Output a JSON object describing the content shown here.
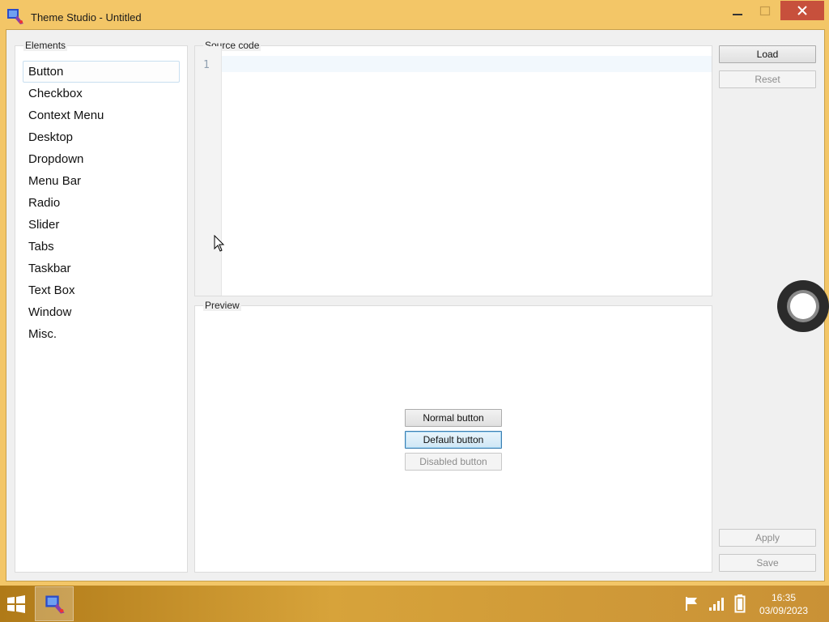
{
  "window": {
    "title": "Theme Studio - Untitled",
    "minimize": "minimize",
    "maximize": "maximize",
    "close": "close"
  },
  "elements": {
    "label": "Elements",
    "items": [
      "Button",
      "Checkbox",
      "Context Menu",
      "Desktop",
      "Dropdown",
      "Menu Bar",
      "Radio",
      "Slider",
      "Tabs",
      "Taskbar",
      "Text Box",
      "Window",
      "Misc."
    ],
    "selected": "Button"
  },
  "source": {
    "label": "Source code",
    "line_numbers": [
      "1"
    ]
  },
  "preview": {
    "label": "Preview",
    "normal_button": "Normal button",
    "default_button": "Default button",
    "disabled_button": "Disabled button"
  },
  "side_buttons": {
    "load": "Load",
    "reset": "Reset",
    "apply": "Apply",
    "save": "Save"
  },
  "taskbar": {
    "time": "16:35",
    "date": "03/09/2023",
    "icons": [
      "windows-start-icon",
      "theme-studio-app-icon",
      "flag-icon",
      "signal-icon",
      "battery-icon"
    ]
  },
  "colors": {
    "titlebar": "#f3c667",
    "close_button": "#c7503c",
    "default_button_border": "#3c7fb1"
  }
}
